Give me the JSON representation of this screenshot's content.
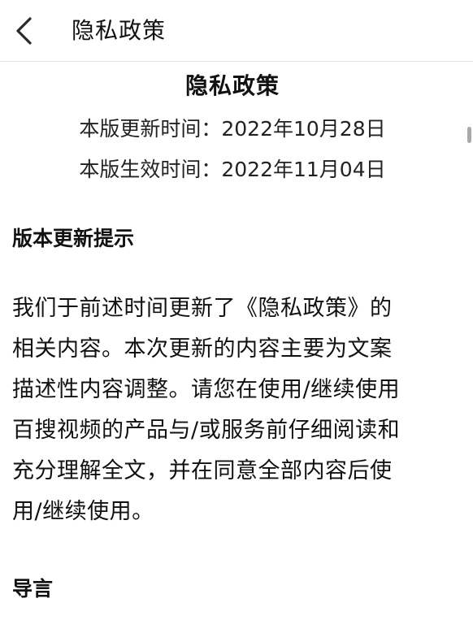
{
  "header": {
    "back_icon": "chevron-left-icon",
    "title": "隐私政策"
  },
  "document": {
    "title": "隐私政策",
    "updated_line": "本版更新时间：2022年10月28日",
    "effective_line": "本版生效时间：2022年11月04日",
    "sections": [
      {
        "heading": "版本更新提示",
        "paragraph_lines": [
          "我们于前述时间更新了《隐私政策》的",
          "相关内容。本次更新的内容主要为文案",
          "描述性内容调整。请您在使用/继续使用",
          "百搜视频的产品与/或服务前仔细阅读和",
          "充分理解全文，并在同意全部内容后使",
          "用/继续使用。"
        ]
      },
      {
        "heading": "导言"
      }
    ]
  },
  "colors": {
    "background": "#ffffff",
    "text": "#111111",
    "divider": "#e7e7e7",
    "scrollbar": "#a9a9a9"
  }
}
